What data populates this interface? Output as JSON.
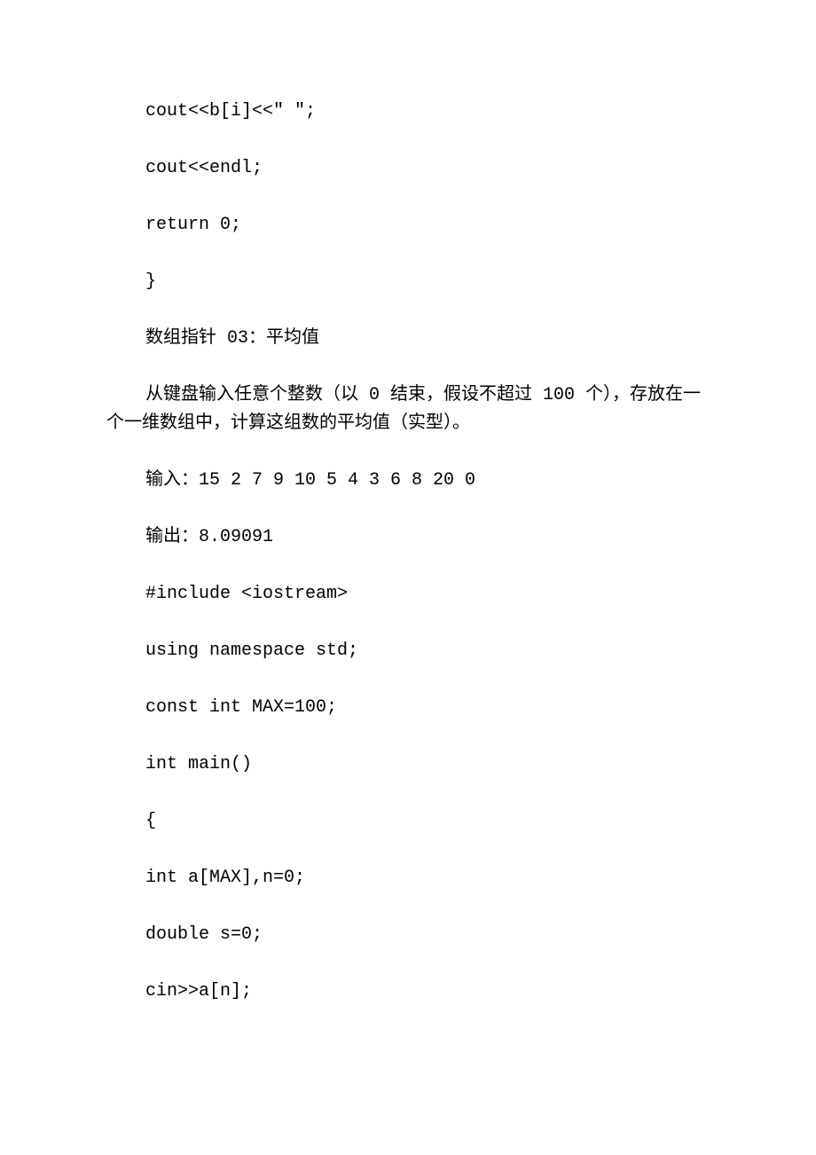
{
  "lines": {
    "l1": "cout<<b[i]<<\" \";",
    "l2": "cout<<endl;",
    "l3": "return 0;",
    "l4": "}",
    "l5": "数组指针 03：平均值",
    "l6": "从键盘输入任意个整数（以 0 结束，假设不超过 100 个），存放在一个一维数组中，计算这组数的平均值（实型）。",
    "l7": "输入：15 2 7 9 10 5 4 3 6 8 20 0",
    "l8": "输出：8.09091",
    "l9": "#include <iostream>",
    "l10": "using namespace std;",
    "l11": "const int MAX=100;",
    "l12": "int main()",
    "l13": "{",
    "l14": "int a[MAX],n=0;",
    "l15": "double s=0;",
    "l16": "cin>>a[n];"
  }
}
